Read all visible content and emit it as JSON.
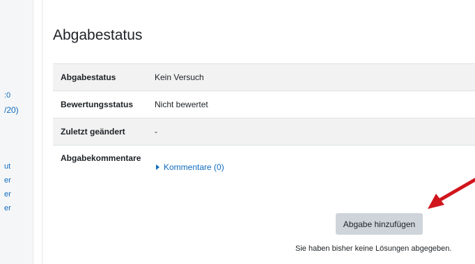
{
  "drawer": {
    "items": [
      {
        "label": ":0"
      },
      {
        "label": "/20)"
      },
      {
        "label": "ut"
      },
      {
        "label": "er"
      },
      {
        "label": "er"
      },
      {
        "label": "er"
      }
    ]
  },
  "heading": "Abgabestatus",
  "status": {
    "rows": [
      {
        "label": "Abgabestatus",
        "value": "Kein Versuch"
      },
      {
        "label": "Bewertungsstatus",
        "value": "Nicht bewertet"
      },
      {
        "label": "Zuletzt geändert",
        "value": "-"
      },
      {
        "label": "Abgabekommentare",
        "value": "Kommentare (0)"
      }
    ]
  },
  "actions": {
    "add_submission_label": "Abgabe hinzufügen",
    "note": "Sie haben bisher keine Lösungen abgegeben."
  },
  "colors": {
    "link": "#0f6cbf",
    "arrow": "#d0161c",
    "button": "#ced4da",
    "row_stripe": "#f2f2f2"
  },
  "icons": {
    "comments_toggle": "caret-right-icon",
    "annotation": "red-arrow-icon"
  }
}
